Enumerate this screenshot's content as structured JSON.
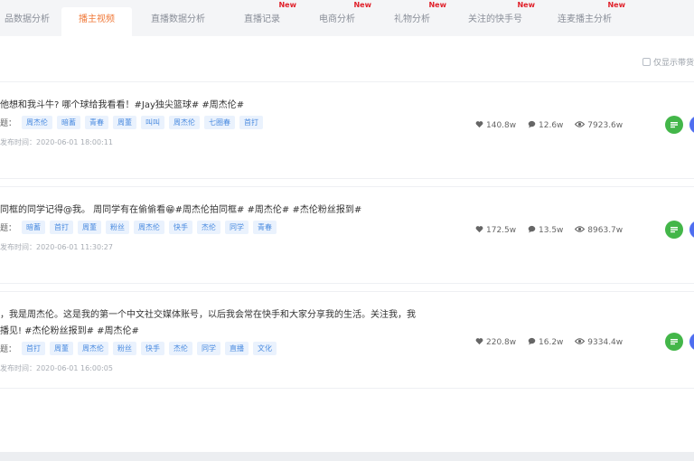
{
  "tabs": [
    {
      "label": "品数据分析",
      "new": ""
    },
    {
      "label": "播主视频",
      "new": ""
    },
    {
      "label": "直播数据分析",
      "new": ""
    },
    {
      "label": "直播记录",
      "new": "New"
    },
    {
      "label": "电商分析",
      "new": "New"
    },
    {
      "label": "礼物分析",
      "new": "New"
    },
    {
      "label": "关注的快手号",
      "new": "New"
    },
    {
      "label": "连麦播主分析",
      "new": "New"
    }
  ],
  "toggle_label": "仅显示带货",
  "tag_label": "题：",
  "videos": [
    {
      "title_lines": [
        "他想和我斗牛? 哪个球给我看看！#Jay独尖篮球# #周杰伦#"
      ],
      "tags": [
        "周杰伦",
        "暗蓄",
        "青春",
        "周董",
        "叫叫",
        "周杰伦",
        "七圈春",
        "首打"
      ],
      "time": "发布时间：2020-06-01 18:00:11",
      "likes": "140.8w",
      "comments": "12.6w",
      "views": "7923.6w"
    },
    {
      "title_lines": [
        "同框的同学记得@我。 周同学有在偷偷看😁#周杰伦拍同框# #周杰伦# #杰伦粉丝报到#"
      ],
      "tags": [
        "暗蓄",
        "首打",
        "周董",
        "粉丝",
        "周杰伦",
        "快手",
        "杰伦",
        "同学",
        "青春"
      ],
      "time": "发布时间：2020-06-01 11:30:27",
      "likes": "172.5w",
      "comments": "13.5w",
      "views": "8963.7w"
    },
    {
      "title_lines": [
        "，我是周杰伦。这是我的第一个中文社交媒体账号，以后我会常在快手和大家分享我的生活。关注我，我",
        "播见! #杰伦粉丝报到# #周杰伦#"
      ],
      "tags": [
        "首打",
        "周董",
        "周杰伦",
        "粉丝",
        "快手",
        "杰伦",
        "同学",
        "直播",
        "文化"
      ],
      "time": "发布时间：2020-06-01 16:00:05",
      "likes": "220.8w",
      "comments": "16.2w",
      "views": "9334.4w"
    }
  ]
}
